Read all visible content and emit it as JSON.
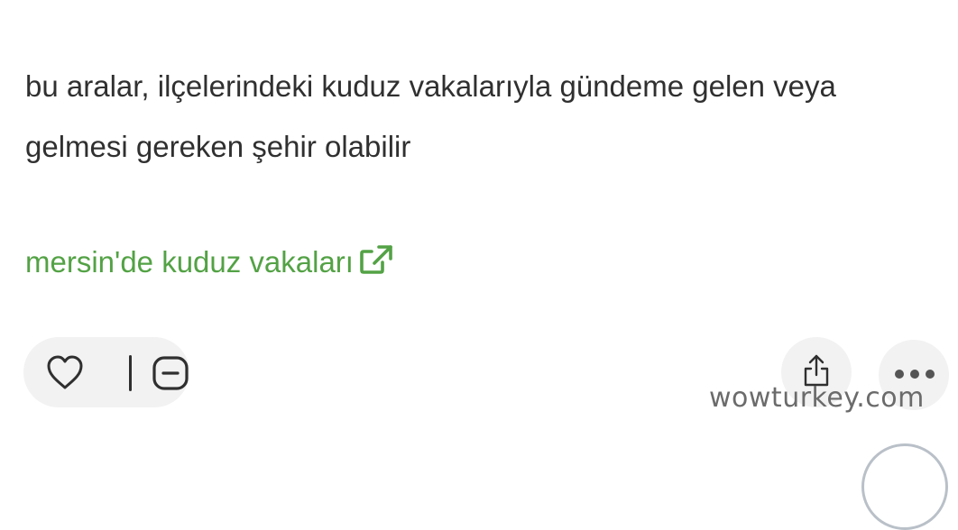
{
  "entry": {
    "text_line1": "bu aralar, ilçelerindeki kuduz vakalarıyla gündeme gelen veya",
    "text_line2": "gelmesi gereken şehir olabilir",
    "link_label": "mersin'de kuduz vakaları",
    "link_icon": "external-link-icon"
  },
  "actions": {
    "like_icon": "heart-icon",
    "dislike_icon": "minus-box-icon",
    "share_icon": "share-icon",
    "more_icon": "more-dots-icon"
  },
  "watermark": "wowturkey.com",
  "colors": {
    "text": "#303030",
    "link": "#53a245",
    "button_bg": "#f2f2f2",
    "icon": "#2f2f2f"
  }
}
